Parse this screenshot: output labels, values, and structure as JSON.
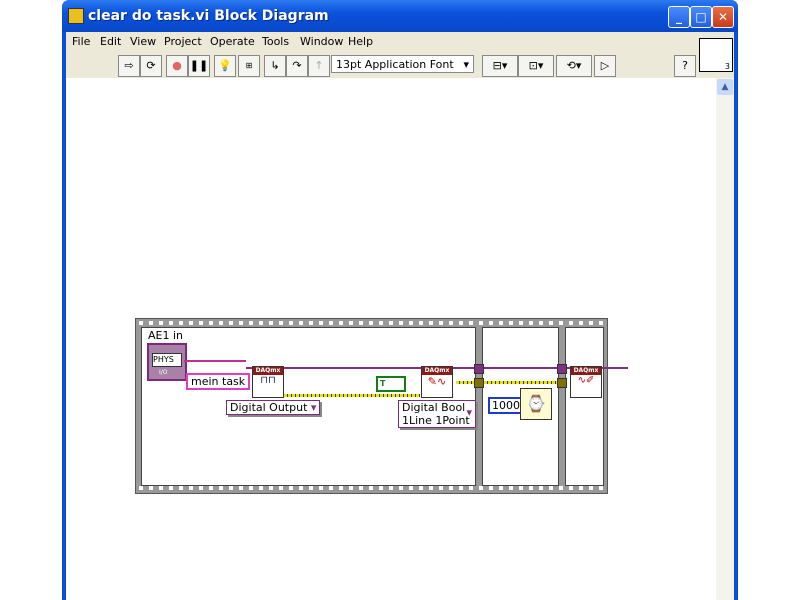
{
  "window": {
    "title": "clear do task.vi Block Diagram",
    "buttons": [
      "minimize",
      "maximize",
      "close"
    ]
  },
  "menu": [
    "File",
    "Edit",
    "View",
    "Project",
    "Operate",
    "Tools",
    "Window",
    "Help"
  ],
  "toolbar": {
    "font": "13pt Application Font",
    "buttons": [
      "run-icon",
      "run-continuously-icon",
      "abort-icon",
      "pause-icon",
      "highlight-execution-icon",
      "retain-wire-values-icon",
      "step-into-icon",
      "step-over-icon",
      "step-out-icon",
      "align-icon",
      "distribute-icon",
      "reorder-icon",
      "cleanup-icon",
      "help-icon"
    ]
  },
  "connector_pane": {
    "number": "3"
  },
  "diagram": {
    "control_label": "AE1 in",
    "phys_label": "PHYS",
    "io_label": "I/O",
    "task_name": "mein task",
    "daqmx_label": "DAQmx",
    "create_channel_type": "Digital Output",
    "write_type_line1": "Digital Bool",
    "write_type_line2": "1Line 1Point",
    "bool_const": "T",
    "wait_ms": "1000"
  }
}
